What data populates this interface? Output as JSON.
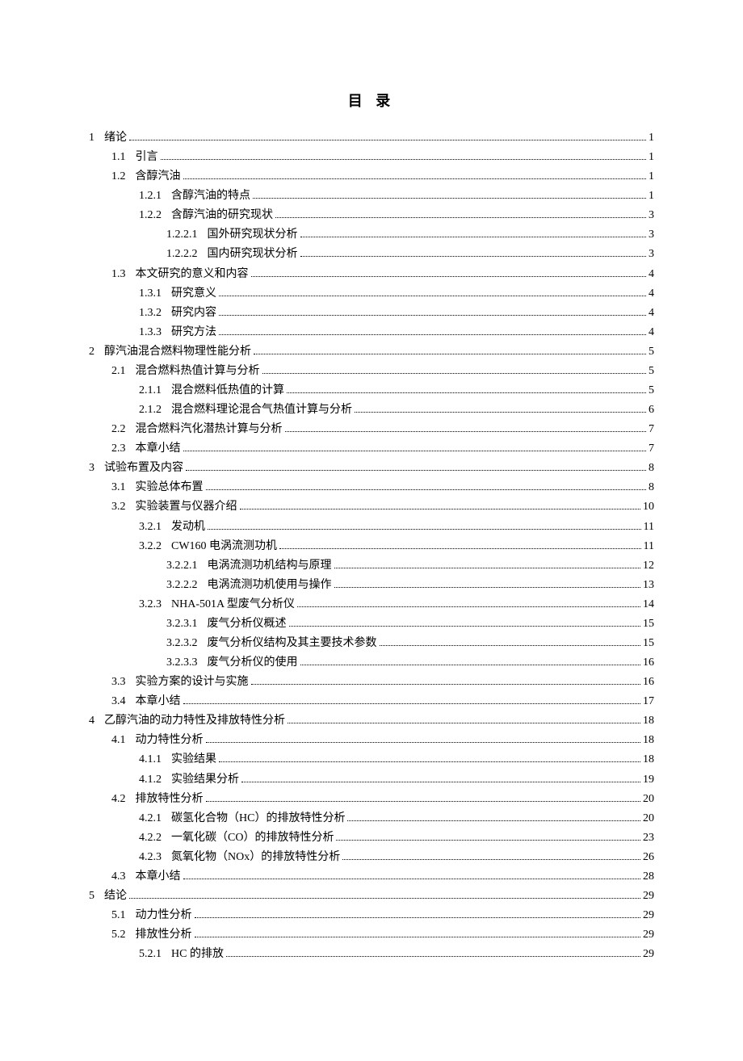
{
  "title": "目 录",
  "toc": [
    {
      "level": 1,
      "num": "1",
      "label": "绪论",
      "page": "1"
    },
    {
      "level": 2,
      "num": "1.1",
      "label": "引言",
      "page": "1"
    },
    {
      "level": 2,
      "num": "1.2",
      "label": "含醇汽油",
      "page": "1"
    },
    {
      "level": 3,
      "num": "1.2.1",
      "label": "含醇汽油的特点",
      "page": "1"
    },
    {
      "level": 3,
      "num": "1.2.2",
      "label": "含醇汽油的研究现状",
      "page": "3"
    },
    {
      "level": 4,
      "num": "1.2.2.1",
      "label": "国外研究现状分析",
      "page": "3"
    },
    {
      "level": 4,
      "num": "1.2.2.2",
      "label": "国内研究现状分析",
      "page": "3"
    },
    {
      "level": 2,
      "num": "1.3",
      "label": "本文研究的意义和内容",
      "page": "4"
    },
    {
      "level": 3,
      "num": "1.3.1",
      "label": "研究意义",
      "page": "4"
    },
    {
      "level": 3,
      "num": "1.3.2",
      "label": "研究内容",
      "page": "4"
    },
    {
      "level": 3,
      "num": "1.3.3",
      "label": "研究方法",
      "page": "4"
    },
    {
      "level": 1,
      "num": "2",
      "label": "醇汽油混合燃料物理性能分析",
      "page": "5"
    },
    {
      "level": 2,
      "num": "2.1",
      "label": "混合燃料热值计算与分析",
      "page": "5"
    },
    {
      "level": 3,
      "num": "2.1.1",
      "label": "混合燃料低热值的计算",
      "page": "5"
    },
    {
      "level": 3,
      "num": "2.1.2",
      "label": "混合燃料理论混合气热值计算与分析",
      "page": "6"
    },
    {
      "level": 2,
      "num": "2.2",
      "label": "混合燃料汽化潜热计算与分析",
      "page": "7"
    },
    {
      "level": 2,
      "num": "2.3",
      "label": "本章小结",
      "page": "7"
    },
    {
      "level": 1,
      "num": "3",
      "label": "试验布置及内容",
      "page": "8"
    },
    {
      "level": 2,
      "num": "3.1",
      "label": "实验总体布置",
      "page": "8"
    },
    {
      "level": 2,
      "num": "3.2",
      "label": "实验装置与仪器介绍",
      "page": "10"
    },
    {
      "level": 3,
      "num": "3.2.1",
      "label": "发动机",
      "page": "11"
    },
    {
      "level": 3,
      "num": "3.2.2",
      "label": "CW160 电涡流测功机",
      "page": "11"
    },
    {
      "level": 4,
      "num": "3.2.2.1",
      "label": "电涡流测功机结构与原理",
      "page": "12"
    },
    {
      "level": 4,
      "num": "3.2.2.2",
      "label": "电涡流测功机使用与操作",
      "page": "13"
    },
    {
      "level": 3,
      "num": "3.2.3",
      "label": "NHA-501A 型废气分析仪",
      "page": "14"
    },
    {
      "level": 4,
      "num": "3.2.3.1",
      "label": "废气分析仪概述",
      "page": "15"
    },
    {
      "level": 4,
      "num": "3.2.3.2",
      "label": "废气分析仪结构及其主要技术参数",
      "page": "15"
    },
    {
      "level": 4,
      "num": "3.2.3.3",
      "label": "废气分析仪的使用",
      "page": "16"
    },
    {
      "level": 2,
      "num": "3.3",
      "label": "实验方案的设计与实施",
      "page": "16"
    },
    {
      "level": 2,
      "num": "3.4",
      "label": "本章小结",
      "page": "17"
    },
    {
      "level": 1,
      "num": "4",
      "label": "乙醇汽油的动力特性及排放特性分析",
      "page": "18"
    },
    {
      "level": 2,
      "num": "4.1",
      "label": "动力特性分析",
      "page": "18"
    },
    {
      "level": 3,
      "num": "4.1.1",
      "label": "实验结果",
      "page": "18"
    },
    {
      "level": 3,
      "num": "4.1.2",
      "label": "实验结果分析",
      "page": "19"
    },
    {
      "level": 2,
      "num": "4.2",
      "label": "排放特性分析",
      "page": "20"
    },
    {
      "level": 3,
      "num": "4.2.1",
      "label": "碳氢化合物（HC）的排放特性分析",
      "page": "20"
    },
    {
      "level": 3,
      "num": "4.2.2",
      "label": "一氧化碳（CO）的排放特性分析",
      "page": "23"
    },
    {
      "level": 3,
      "num": "4.2.3",
      "label": "氮氧化物（NOx）的排放特性分析",
      "page": "26"
    },
    {
      "level": 2,
      "num": "4.3",
      "label": "本章小结",
      "page": "28"
    },
    {
      "level": 1,
      "num": "5",
      "label": "结论",
      "page": "29"
    },
    {
      "level": 2,
      "num": "5.1",
      "label": "动力性分析",
      "page": "29"
    },
    {
      "level": 2,
      "num": "5.2",
      "label": "排放性分析",
      "page": "29"
    },
    {
      "level": 3,
      "num": "5.2.1",
      "label": "HC 的排放",
      "page": "29"
    }
  ]
}
